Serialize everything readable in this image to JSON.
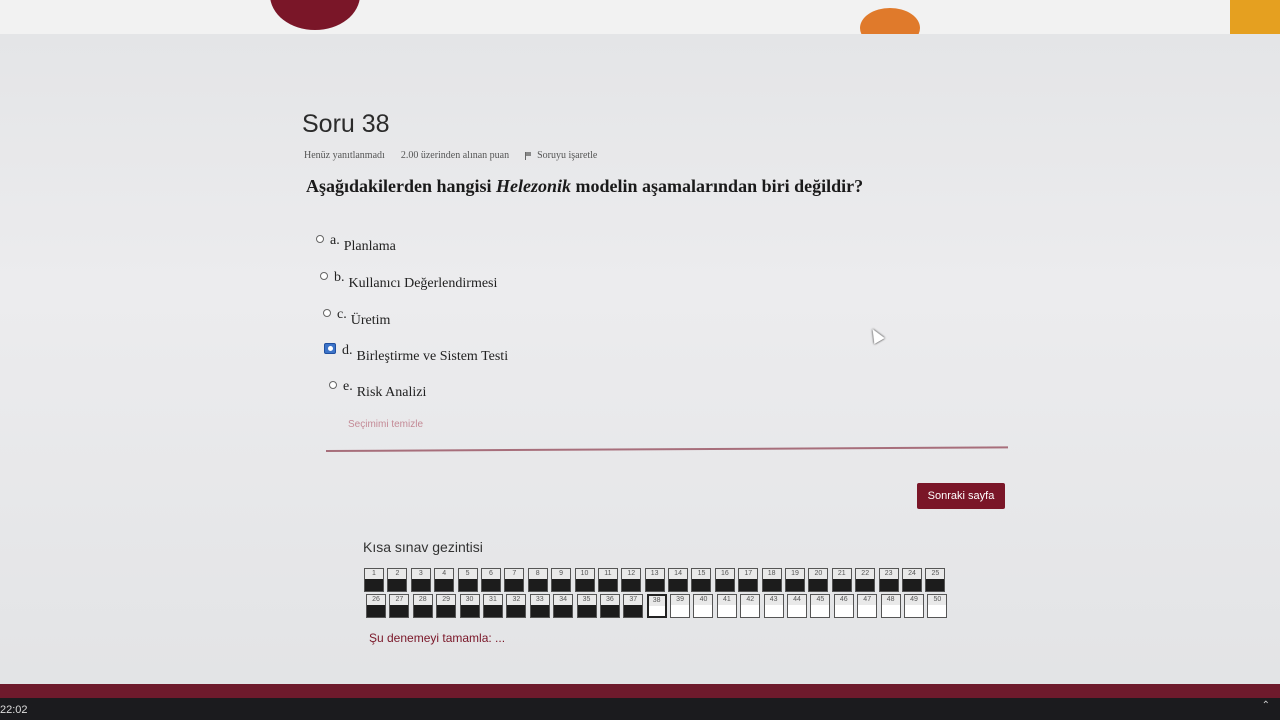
{
  "question": {
    "title": "Soru 38",
    "status": "Henüz yanıtlanmadı",
    "points": "2.00 üzerinden alınan puan",
    "flag_label": "Soruyu işaretle",
    "text_before": "Aşağıdakilerden hangisi ",
    "text_emph": "Helezonik",
    "text_after": " modelin aşamalarından biri değildir?"
  },
  "options": [
    {
      "letter": "a.",
      "label": "Planlama",
      "selected": false
    },
    {
      "letter": "b.",
      "label": "Kullanıcı Değerlendirmesi",
      "selected": false
    },
    {
      "letter": "c.",
      "label": "Üretim",
      "selected": false
    },
    {
      "letter": "d.",
      "label": "Birleştirme ve Sistem Testi",
      "selected": true
    },
    {
      "letter": "e.",
      "label": "Risk Analizi",
      "selected": false
    }
  ],
  "clear_choice": "Seçimimi temizle",
  "next_button": "Sonraki sayfa",
  "navigation": {
    "title": "Kısa sınav gezintisi",
    "row1": [
      "1",
      "2",
      "3",
      "4",
      "5",
      "6",
      "7",
      "8",
      "9",
      "10",
      "11",
      "12",
      "13",
      "14",
      "15",
      "16",
      "17",
      "18",
      "19",
      "20",
      "21",
      "22",
      "23",
      "24",
      "25"
    ],
    "row2": [
      "26",
      "27",
      "28",
      "29",
      "30",
      "31",
      "32",
      "33",
      "34",
      "35",
      "36",
      "37",
      "38",
      "39",
      "40",
      "41",
      "42",
      "43",
      "44",
      "45",
      "46",
      "47",
      "48",
      "49",
      "50"
    ],
    "answered_upto": 37,
    "current": 38
  },
  "finish_link": "Şu denemeyi tamamla: ...",
  "taskbar": {
    "clock": "22:02"
  },
  "colors": {
    "accent": "#7a1628",
    "selected_radio": "#3c73c8"
  }
}
